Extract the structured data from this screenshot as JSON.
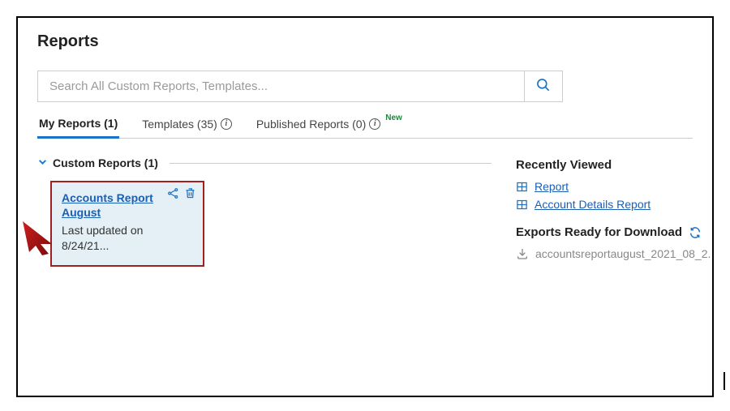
{
  "page": {
    "title": "Reports"
  },
  "search": {
    "placeholder": "Search All Custom Reports, Templates..."
  },
  "tabs": {
    "my_reports": "My Reports (1)",
    "templates": "Templates (35)",
    "published": "Published Reports (0)",
    "new_badge": "New"
  },
  "section": {
    "custom_reports": "Custom Reports (1)"
  },
  "card": {
    "title": "Accounts Report August",
    "meta": "Last updated on 8/24/21..."
  },
  "sidebar": {
    "recently_viewed_heading": "Recently Viewed",
    "items": [
      {
        "label": "Report"
      },
      {
        "label": "Account Details Report"
      }
    ],
    "exports_heading": "Exports Ready for Download",
    "export_file": "accountsreportaugust_2021_08_2."
  }
}
